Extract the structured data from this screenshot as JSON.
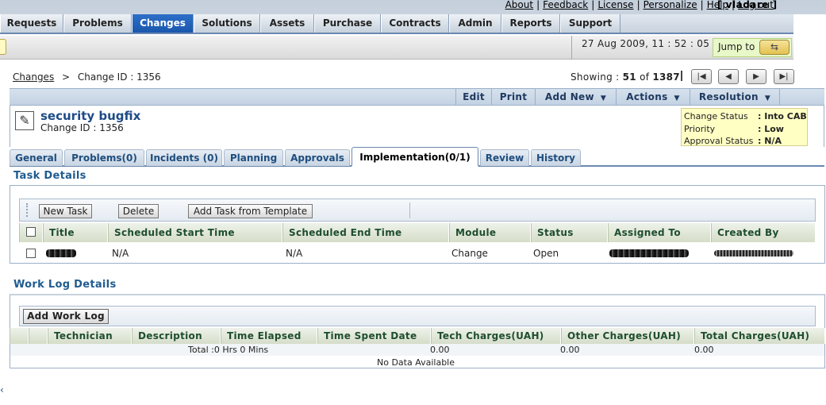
{
  "top_links": {
    "about": "About",
    "feedback": "Feedback",
    "license": "License",
    "personalize": "Personalize",
    "help": "Help",
    "logout": "Log out",
    "user": "[ vladare ]"
  },
  "main_tabs": [
    {
      "label": "Requests",
      "active": false
    },
    {
      "label": "Problems",
      "active": false
    },
    {
      "label": "Changes",
      "active": true
    },
    {
      "label": "Solutions",
      "active": false
    },
    {
      "label": "Assets",
      "active": false
    },
    {
      "label": "Purchase",
      "active": false
    },
    {
      "label": "Contracts",
      "active": false
    },
    {
      "label": "Admin",
      "active": false
    },
    {
      "label": "Reports",
      "active": false
    },
    {
      "label": "Support",
      "active": false
    }
  ],
  "datetime": "27 Aug 2009, 11 : 52 : 05",
  "jump_to": {
    "label": "Jump to",
    "icon": "jump-arrows-icon"
  },
  "breadcrumb": {
    "root": "Changes",
    "sep": ">",
    "current": "Change ID : 1356"
  },
  "showing": {
    "prefix": "Showing :",
    "current": "51",
    "of": "of",
    "total": "1387"
  },
  "actions": {
    "edit": "Edit",
    "print": "Print",
    "add_new": "Add New",
    "actions": "Actions",
    "resolution": "Resolution"
  },
  "change": {
    "title": "security bugfix",
    "id_text": "Change ID : 1356",
    "icon": "edit-note-icon"
  },
  "status": {
    "change_status_label": "Change Status",
    "change_status_value": ": Into CAB",
    "priority_label": "Priority",
    "priority_value": ": Low",
    "approval_label": "Approval Status",
    "approval_value": ": N/A"
  },
  "sub_tabs": [
    {
      "label": "General",
      "active": false
    },
    {
      "label": "Problems(0)",
      "active": false
    },
    {
      "label": "Incidents (0)",
      "active": false
    },
    {
      "label": "Planning",
      "active": false
    },
    {
      "label": "Approvals",
      "active": false
    },
    {
      "label": "Implementation(0/1)",
      "active": true
    },
    {
      "label": "Review",
      "active": false
    },
    {
      "label": "History",
      "active": false
    }
  ],
  "task_section": {
    "title": "Task Details",
    "new_task": "New Task",
    "delete": "Delete",
    "add_template": "Add Task from Template"
  },
  "task_columns": [
    "Title",
    "Scheduled Start Time",
    "Scheduled End Time",
    "Module",
    "Status",
    "Assigned To",
    "Created By"
  ],
  "task_rows": [
    {
      "title": "[redacted]",
      "start": "N/A",
      "end": "N/A",
      "module": "Change",
      "status": "Open",
      "assigned": "[redacted]",
      "created": "[redacted]"
    }
  ],
  "worklog_section": {
    "title": "Work Log Details",
    "add_button": "Add Work Log"
  },
  "worklog_columns": [
    "Technician",
    "Description",
    "Time Elapsed",
    "Time Spent Date",
    "Tech Charges(UAH)",
    "Other Charges(UAH)",
    "Total Charges(UAH)"
  ],
  "worklog_totals": {
    "total_time": "Total :0 Hrs 0 Mins",
    "tech": "0.00",
    "other": "0.00",
    "total": "0.00"
  },
  "worklog_empty": "No Data Available",
  "colors": {
    "active_tab": "#1a57ad",
    "section_title": "#1f5b8f",
    "status_bg": "#ffffc4"
  }
}
